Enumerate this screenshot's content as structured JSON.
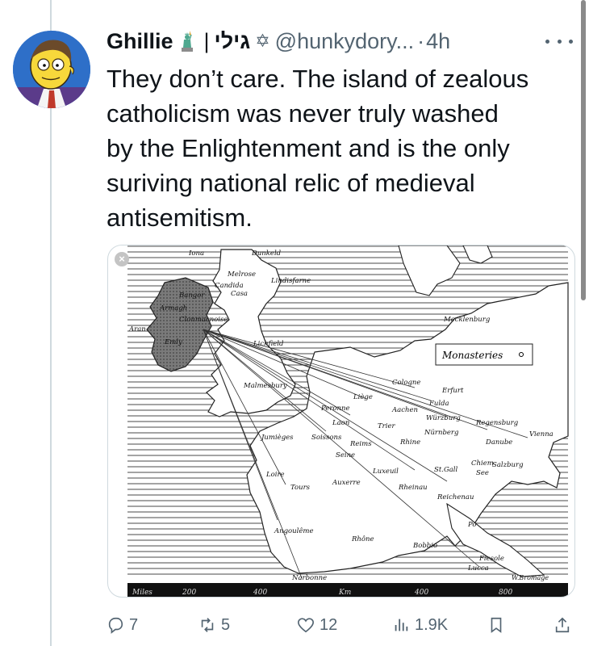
{
  "tweet": {
    "author_name": "Ghillie",
    "separator": "|",
    "hebrew_name": "גילי",
    "handle": "@hunkydory...",
    "dot": "·",
    "time": "4h",
    "lines": [
      "They don’t care. The island of zealous",
      "catholicism was never truly washed",
      "by the Enlightenment and is the only",
      "suriving national relic of medieval",
      "antisemitism."
    ]
  },
  "map": {
    "legend_title": "Monasteries",
    "places": {
      "iona": "Iona",
      "dunkeld": "Dunkeld",
      "melrose": "Melrose",
      "candida": "Candida",
      "casa": "Casa",
      "lindisfarne": "Lindisfarne",
      "bangor": "Bangor",
      "armagh": "Armagh",
      "clonmacnoise": "Clonmacnoise",
      "aran": "Aran",
      "emly": "Emly",
      "lichfield": "Lichfield",
      "malmesbury": "Malmesbury",
      "mecklenburg": "Mecklenburg",
      "cologne": "Cologne",
      "erfurt": "Erfurt",
      "fulda": "Fulda",
      "liege": "Liège",
      "aachen": "Aachen",
      "peronne": "Peronne",
      "laon": "Laon",
      "trier": "Trier",
      "wurzburg": "Würzburg",
      "regensburg": "Regensburg",
      "nurnberg": "Nürnberg",
      "vienna": "Vienna",
      "danube": "Danube",
      "jumieges": "Jumièges",
      "soissons": "Soissons",
      "reims": "Reims",
      "seine": "Seine",
      "rhine": "Rhine",
      "loire": "Loire",
      "tours": "Tours",
      "auxerre": "Auxerre",
      "luxeuil": "Luxeuil",
      "stgall": "St.Gall",
      "chiemsee": "Chiem",
      "see": "See",
      "salzburg": "Salzburg",
      "rheinau": "Rheinau",
      "reichenau": "Reichenau",
      "angouleme": "Angoulême",
      "rhone": "Rhône",
      "po": "Po",
      "bobbio": "Bobbio",
      "fiesole": "Fiesole",
      "lucca": "Lucca",
      "narbonne": "Narbonne"
    },
    "scale": {
      "miles": "Miles",
      "m200": "200",
      "m400": "400",
      "km": "Km",
      "k400": "400",
      "k800": "800",
      "credit": "W.Bromage"
    }
  },
  "actions": {
    "replies": "7",
    "reposts": "5",
    "likes": "12",
    "views": "1.9K"
  },
  "colors": {
    "text": "#0f1419",
    "secondary": "#536471",
    "border": "#cfd9de"
  },
  "icons": [
    "avatar",
    "statue-of-liberty-icon",
    "star-of-david-icon",
    "more-icon",
    "close-icon",
    "reply-icon",
    "repost-icon",
    "like-icon",
    "views-icon",
    "bookmark-icon",
    "share-icon"
  ]
}
